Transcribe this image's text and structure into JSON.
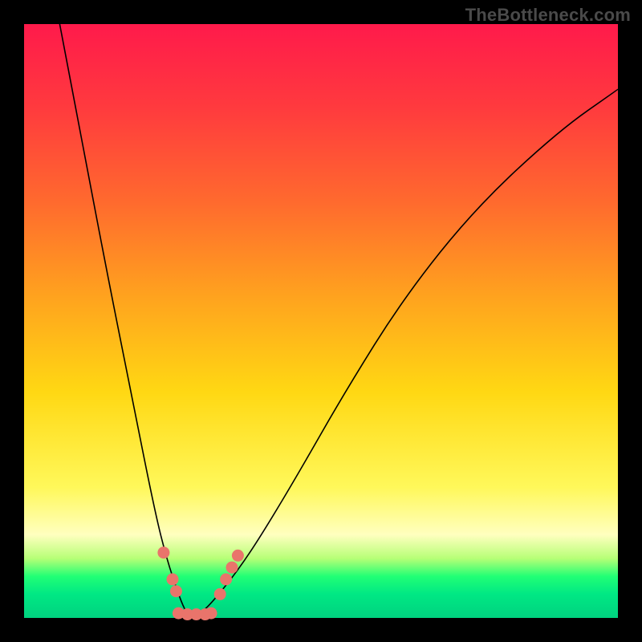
{
  "watermark_text": "TheBottleneck.com",
  "colors": {
    "frame": "#000000",
    "curve": "#000000",
    "marker": "#e9746b",
    "gradient_top": "#ff1a4b",
    "gradient_bottom": "#00d27f"
  },
  "chart_data": {
    "type": "line",
    "title": "",
    "xlabel": "",
    "ylabel": "",
    "xlim": [
      0,
      100
    ],
    "ylim": [
      0,
      100
    ],
    "note": "Axes are unitless (the source image shows no tick labels). y=0 is the bottom green band, y=100 is the top red edge. Two curves form a V meeting near x≈28, y≈0.",
    "series": [
      {
        "name": "left-curve",
        "x": [
          6,
          10,
          14,
          18,
          22,
          24,
          26,
          27,
          28
        ],
        "y": [
          100,
          79,
          58,
          38,
          18,
          10,
          4,
          1.5,
          0
        ]
      },
      {
        "name": "right-curve",
        "x": [
          28,
          30,
          32,
          36,
          40,
          46,
          54,
          64,
          76,
          90,
          100
        ],
        "y": [
          0,
          1,
          3,
          8,
          14,
          24,
          38,
          54,
          69,
          82,
          89
        ]
      }
    ],
    "markers": {
      "name": "highlighted-points",
      "note": "Salmon dots clustered around the trough and the flat green segment between the two curves.",
      "points": [
        {
          "x": 23.5,
          "y": 11
        },
        {
          "x": 25.0,
          "y": 6.5
        },
        {
          "x": 25.6,
          "y": 4.5
        },
        {
          "x": 26.0,
          "y": 0.8
        },
        {
          "x": 27.5,
          "y": 0.6
        },
        {
          "x": 29.0,
          "y": 0.6
        },
        {
          "x": 30.5,
          "y": 0.6
        },
        {
          "x": 31.5,
          "y": 0.8
        },
        {
          "x": 33.0,
          "y": 4.0
        },
        {
          "x": 34.0,
          "y": 6.5
        },
        {
          "x": 35.0,
          "y": 8.5
        },
        {
          "x": 36.0,
          "y": 10.5
        }
      ]
    }
  }
}
